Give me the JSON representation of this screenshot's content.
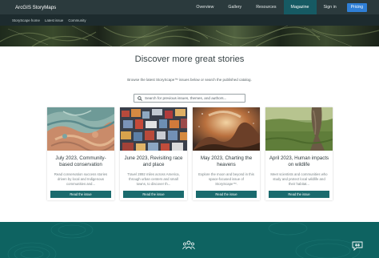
{
  "nav": {
    "brand": "ArcGIS StoryMaps",
    "links": [
      "Overview",
      "Gallery",
      "Resources",
      "Magazine",
      "Sign in"
    ],
    "active": "Magazine",
    "pricing": "Pricing"
  },
  "subnav": {
    "links": [
      "StoryScape home",
      "Latest issue",
      "Community"
    ]
  },
  "main": {
    "title": "Discover more great stories",
    "subtitle": "Browse the latest StoryScape™ issues below or search the published catalog.",
    "search_placeholder": "Search for previous issues, themes, and authors..."
  },
  "cards": [
    {
      "title": "July 2023, Community-based conservation",
      "desc": "Read conservation success stories driven by local and Indigenous communities and...",
      "button": "Read the issue",
      "image": "satellite-terrain"
    },
    {
      "title": "June 2023, Revisiting race and place",
      "desc": "Travel 2892 miles across America, through urban centers and small towns, to discover th...",
      "button": "Read the issue",
      "image": "city-map"
    },
    {
      "title": "May 2023, Charting the heavens",
      "desc": "Explore the moon and beyond in this space-focused issue of StoryScape™.",
      "button": "Read the issue",
      "image": "nebula"
    },
    {
      "title": "April 2023, Human impacts on wildlife",
      "desc": "Meet scientists and communities who study and protect local wildlife and their habitat...",
      "button": "Read the issue",
      "image": "savanna-tree"
    }
  ],
  "footer_icons": [
    "people-icon",
    "chat-icon"
  ],
  "colors": {
    "topnav": "#2b3a3d",
    "subnav": "#1d2b2e",
    "active": "#165a63",
    "pricing": "#2f7fd6",
    "button": "#1b6b6e",
    "band": "#0e6361"
  }
}
